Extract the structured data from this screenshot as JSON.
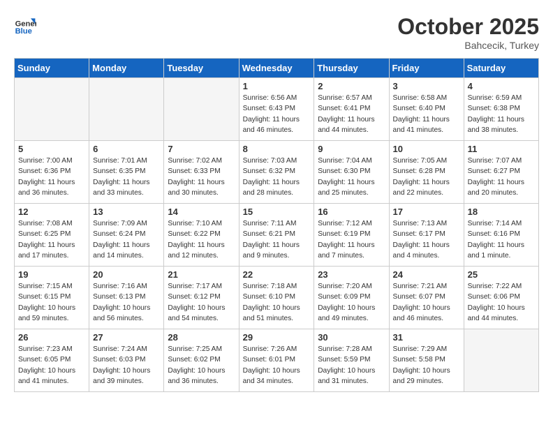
{
  "header": {
    "logo_general": "General",
    "logo_blue": "Blue",
    "month_title": "October 2025",
    "location": "Bahcecik, Turkey"
  },
  "days_of_week": [
    "Sunday",
    "Monday",
    "Tuesday",
    "Wednesday",
    "Thursday",
    "Friday",
    "Saturday"
  ],
  "weeks": [
    [
      {
        "day": "",
        "info": ""
      },
      {
        "day": "",
        "info": ""
      },
      {
        "day": "",
        "info": ""
      },
      {
        "day": "1",
        "info": "Sunrise: 6:56 AM\nSunset: 6:43 PM\nDaylight: 11 hours\nand 46 minutes."
      },
      {
        "day": "2",
        "info": "Sunrise: 6:57 AM\nSunset: 6:41 PM\nDaylight: 11 hours\nand 44 minutes."
      },
      {
        "day": "3",
        "info": "Sunrise: 6:58 AM\nSunset: 6:40 PM\nDaylight: 11 hours\nand 41 minutes."
      },
      {
        "day": "4",
        "info": "Sunrise: 6:59 AM\nSunset: 6:38 PM\nDaylight: 11 hours\nand 38 minutes."
      }
    ],
    [
      {
        "day": "5",
        "info": "Sunrise: 7:00 AM\nSunset: 6:36 PM\nDaylight: 11 hours\nand 36 minutes."
      },
      {
        "day": "6",
        "info": "Sunrise: 7:01 AM\nSunset: 6:35 PM\nDaylight: 11 hours\nand 33 minutes."
      },
      {
        "day": "7",
        "info": "Sunrise: 7:02 AM\nSunset: 6:33 PM\nDaylight: 11 hours\nand 30 minutes."
      },
      {
        "day": "8",
        "info": "Sunrise: 7:03 AM\nSunset: 6:32 PM\nDaylight: 11 hours\nand 28 minutes."
      },
      {
        "day": "9",
        "info": "Sunrise: 7:04 AM\nSunset: 6:30 PM\nDaylight: 11 hours\nand 25 minutes."
      },
      {
        "day": "10",
        "info": "Sunrise: 7:05 AM\nSunset: 6:28 PM\nDaylight: 11 hours\nand 22 minutes."
      },
      {
        "day": "11",
        "info": "Sunrise: 7:07 AM\nSunset: 6:27 PM\nDaylight: 11 hours\nand 20 minutes."
      }
    ],
    [
      {
        "day": "12",
        "info": "Sunrise: 7:08 AM\nSunset: 6:25 PM\nDaylight: 11 hours\nand 17 minutes."
      },
      {
        "day": "13",
        "info": "Sunrise: 7:09 AM\nSunset: 6:24 PM\nDaylight: 11 hours\nand 14 minutes."
      },
      {
        "day": "14",
        "info": "Sunrise: 7:10 AM\nSunset: 6:22 PM\nDaylight: 11 hours\nand 12 minutes."
      },
      {
        "day": "15",
        "info": "Sunrise: 7:11 AM\nSunset: 6:21 PM\nDaylight: 11 hours\nand 9 minutes."
      },
      {
        "day": "16",
        "info": "Sunrise: 7:12 AM\nSunset: 6:19 PM\nDaylight: 11 hours\nand 7 minutes."
      },
      {
        "day": "17",
        "info": "Sunrise: 7:13 AM\nSunset: 6:17 PM\nDaylight: 11 hours\nand 4 minutes."
      },
      {
        "day": "18",
        "info": "Sunrise: 7:14 AM\nSunset: 6:16 PM\nDaylight: 11 hours\nand 1 minute."
      }
    ],
    [
      {
        "day": "19",
        "info": "Sunrise: 7:15 AM\nSunset: 6:15 PM\nDaylight: 10 hours\nand 59 minutes."
      },
      {
        "day": "20",
        "info": "Sunrise: 7:16 AM\nSunset: 6:13 PM\nDaylight: 10 hours\nand 56 minutes."
      },
      {
        "day": "21",
        "info": "Sunrise: 7:17 AM\nSunset: 6:12 PM\nDaylight: 10 hours\nand 54 minutes."
      },
      {
        "day": "22",
        "info": "Sunrise: 7:18 AM\nSunset: 6:10 PM\nDaylight: 10 hours\nand 51 minutes."
      },
      {
        "day": "23",
        "info": "Sunrise: 7:20 AM\nSunset: 6:09 PM\nDaylight: 10 hours\nand 49 minutes."
      },
      {
        "day": "24",
        "info": "Sunrise: 7:21 AM\nSunset: 6:07 PM\nDaylight: 10 hours\nand 46 minutes."
      },
      {
        "day": "25",
        "info": "Sunrise: 7:22 AM\nSunset: 6:06 PM\nDaylight: 10 hours\nand 44 minutes."
      }
    ],
    [
      {
        "day": "26",
        "info": "Sunrise: 7:23 AM\nSunset: 6:05 PM\nDaylight: 10 hours\nand 41 minutes."
      },
      {
        "day": "27",
        "info": "Sunrise: 7:24 AM\nSunset: 6:03 PM\nDaylight: 10 hours\nand 39 minutes."
      },
      {
        "day": "28",
        "info": "Sunrise: 7:25 AM\nSunset: 6:02 PM\nDaylight: 10 hours\nand 36 minutes."
      },
      {
        "day": "29",
        "info": "Sunrise: 7:26 AM\nSunset: 6:01 PM\nDaylight: 10 hours\nand 34 minutes."
      },
      {
        "day": "30",
        "info": "Sunrise: 7:28 AM\nSunset: 5:59 PM\nDaylight: 10 hours\nand 31 minutes."
      },
      {
        "day": "31",
        "info": "Sunrise: 7:29 AM\nSunset: 5:58 PM\nDaylight: 10 hours\nand 29 minutes."
      },
      {
        "day": "",
        "info": ""
      }
    ]
  ]
}
